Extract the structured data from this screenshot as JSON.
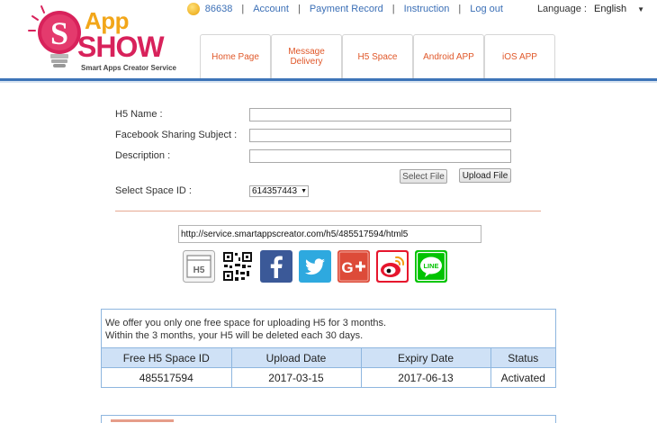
{
  "brand": {
    "app": "App",
    "show": "SHOW",
    "tagline": "Smart Apps Creator Service"
  },
  "topbar": {
    "coins": "86638",
    "account": "Account",
    "payment_record": "Payment Record",
    "instruction": "Instruction",
    "logout": "Log out",
    "language_label": "Language :",
    "language_value": "English"
  },
  "tabs": [
    {
      "label": "Home Page"
    },
    {
      "label": "Message Delivery"
    },
    {
      "label": "H5 Space"
    },
    {
      "label": "Android APP"
    },
    {
      "label": "iOS APP"
    }
  ],
  "form": {
    "h5_name_label": "H5 Name :",
    "facebook_subject_label": "Facebook Sharing Subject :",
    "description_label": "Description :",
    "select_file": "Select File",
    "upload_file": "Upload File",
    "space_id_label": "Select Space ID :",
    "space_id_value": "614357443"
  },
  "share": {
    "url": "http://service.smartappscreator.com/h5/485517594/html5",
    "h5_icon_text": "H5",
    "line_icon_text": "LINE",
    "icons": [
      "h5-icon",
      "qr-code-icon",
      "facebook-icon",
      "twitter-icon",
      "google-plus-icon",
      "weibo-icon",
      "line-icon"
    ],
    "colors": {
      "facebook": "#3b5998",
      "twitter": "#2ea9df",
      "google_plus": "#dd4b39",
      "weibo": "#e6162d",
      "line": "#00c300"
    }
  },
  "panel": {
    "notice_line1": "We offer you only one free space for uploading H5 for 3 months.",
    "notice_line2": "Within the 3 months, your H5 will be deleted each 30 days.",
    "columns": [
      "Free H5 Space ID",
      "Upload Date",
      "Expiry Date",
      "Status"
    ],
    "rows": [
      [
        "485517594",
        "2017-03-15",
        "2017-06-13",
        "Activated"
      ]
    ]
  },
  "colors": {
    "accent_blue": "#3d74b8",
    "tab_text": "#e0582a",
    "table_header_bg": "#cfe1f6"
  }
}
